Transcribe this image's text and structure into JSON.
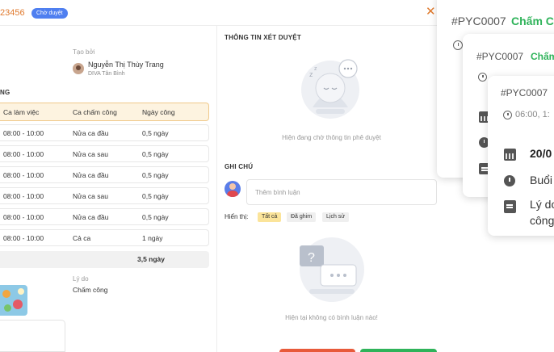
{
  "header": {
    "request_code": "23456",
    "status_badge": "Chờ duyệt",
    "close_glyph": "✕"
  },
  "requester": {
    "created_by_label": "Tạo bởi",
    "name": "Nguyễn Thị Thùy Trang",
    "unit": "DIVA Tân Bình"
  },
  "shift_section": {
    "title_fragment": "NG",
    "columns": [
      "Ca làm việc",
      "Ca chấm công",
      "Ngày công"
    ],
    "rows": [
      {
        "shift": "08:00 - 10:00",
        "attendance": "Nửa ca đầu",
        "days": "0,5 ngày"
      },
      {
        "shift": "08:00 - 10:00",
        "attendance": "Nửa ca sau",
        "days": "0,5 ngày"
      },
      {
        "shift": "08:00 - 10:00",
        "attendance": "Nửa ca đầu",
        "days": "0,5 ngày"
      },
      {
        "shift": "08:00 - 10:00",
        "attendance": "Nửa ca sau",
        "days": "0,5 ngày"
      },
      {
        "shift": "08:00 - 10:00",
        "attendance": "Nửa ca đầu",
        "days": "0,5 ngày"
      },
      {
        "shift": "08:00 - 10:00",
        "attendance": "Cả ca",
        "days": "1 ngày"
      }
    ],
    "total": "3,5 ngày"
  },
  "reason": {
    "label": "Lý do",
    "value": "Chấm công"
  },
  "approval": {
    "title": "THÔNG TIN XÉT DUYỆT",
    "empty_text": "Hiện đang chờ thông tin phê duyệt"
  },
  "notes": {
    "title": "GHI CHÚ",
    "comment_placeholder": "Thêm bình luận",
    "filter_label": "Hiển thị:",
    "filters": [
      "Tất cả",
      "Đã ghim",
      "Lịch sử"
    ],
    "active_filter": "Tất cả",
    "empty_text": "Hiện tại không có bình luận nào!"
  },
  "cards": [
    {
      "code": "#PYC0007",
      "title": "Chấm Cô"
    },
    {
      "code": "#PYC0007",
      "title": "Chấm"
    },
    {
      "code": "#PYC0007",
      "time": "06:00, 1:",
      "date": "20/0",
      "session": "Buổi",
      "reason_line1": "Lý do",
      "reason_line2": "công"
    }
  ],
  "colors": {
    "accent_orange": "#e07a2e",
    "badge_blue": "#4f7ff0",
    "green": "#2fb35a",
    "red": "#e85a3a",
    "table_header_bg": "#fdf3e0"
  }
}
